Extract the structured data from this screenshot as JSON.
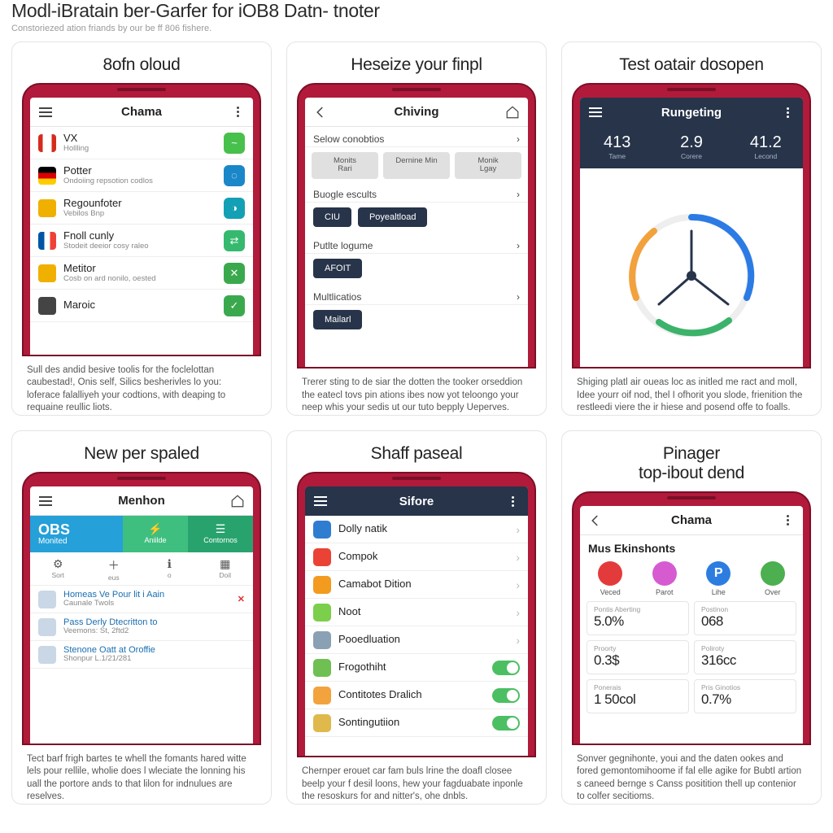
{
  "header": {
    "title": "Modl-iBratain ber-Garfer for iOB8 Datn- tnoter",
    "subtitle": "Constoriezed ation friands by our be ff 806 fishere."
  },
  "cards": [
    {
      "title": "8ofn oloud",
      "desc": "Sull des andid besive toolis for the foclelottan caubestad!, Onis self, Silics besherivles lo you: loferace falalliyeh your codtions, with deaping to requaine reullic liots.",
      "bar": {
        "title": "Chama"
      },
      "rows": [
        {
          "icon": "flag-ca",
          "label": "VX\nHollling",
          "badge": "#47c04c",
          "glyph": "~"
        },
        {
          "icon": "flag-de",
          "label": "Potter",
          "sub": "Ondoiing repsotion codlos",
          "badge": "#1a87c9",
          "glyph": "◌"
        },
        {
          "icon": "ic-car",
          "label": "Regounfoter",
          "sub": "Vebilos Bnp",
          "badge": "#13a0b5",
          "glyph": "◑"
        },
        {
          "icon": "flag-fr",
          "label": "Fnoll cunly",
          "sub": "Stodeit deeior cosy raleo",
          "badge": "#35b96e",
          "glyph": "⇄"
        },
        {
          "icon": "ic-car",
          "label": "Metitor",
          "sub": "Cosb on ard nonilo, oested",
          "badge": "#3aa94e",
          "glyph": "✕"
        },
        {
          "icon": "ic-cam",
          "label": "Maroic",
          "sub": "",
          "badge": "#3aa94e",
          "glyph": "✓"
        }
      ]
    },
    {
      "title": "Heseize your finpl",
      "desc": "Trerer sting to de siar the dotten the tooker orseddion the eatecl tovs pin ations ibes now yot teloongo your neep whis your sedis ut our tuto bepply Ueperves.",
      "bar": {
        "title": "Chiving"
      },
      "sections": [
        {
          "label": "Selow conobtios",
          "chev": true,
          "chips": [
            "Monits\nRari",
            "Dernine Min",
            "Monik\nLgay"
          ]
        },
        {
          "label": "Buogle escults",
          "chev": true,
          "pills": [
            "CIU",
            "Poyealtload"
          ]
        },
        {
          "label": "Putlte logume",
          "chev": true,
          "pills": [
            "AFOIT"
          ]
        },
        {
          "label": "Multlicatios",
          "chev": true,
          "pills": [
            "Mailarl"
          ]
        }
      ]
    },
    {
      "title": "Test oatair dosopen",
      "desc": "Shiging platl air oueas loc as initled me ract and moll, Idee yourr oif nod, thel I ofhorit you slode, frienition the restleedi viere the ir hiese and posend offe to foalls.",
      "bar": {
        "title": "Rungeting"
      },
      "stats": [
        {
          "v": "413",
          "l": "Tame"
        },
        {
          "v": "2.9",
          "l": "Corere"
        },
        {
          "v": "41.2",
          "l": "Lecond"
        }
      ]
    },
    {
      "title": "New per spaled",
      "desc": "Tect barf frigh bartes te whell the fomants hared witte lels pour rellile, wholie does l wleciate the lonning his uall the portore ands to that lilon for indnulues are reselves.",
      "bar": {
        "title": "Menhon"
      },
      "tabs": {
        "obs_big": "OBS",
        "obs_small": "Monited",
        "a2": "Aniilde",
        "a3": "Contornos"
      },
      "iconbar": [
        {
          "g": "⚙",
          "t": "Sort"
        },
        {
          "g": "＋",
          "t": "eus"
        },
        {
          "g": "ℹ",
          "t": "o"
        },
        {
          "g": "▦",
          "t": "Doil"
        }
      ],
      "items": [
        {
          "t": "Homeas Ve Pour lit i Aain",
          "s": "Caunale Twols",
          "x": true
        },
        {
          "t": "Pass Derly Dtecritton to",
          "s": "Veemons: St, 2ftd2"
        },
        {
          "t": "Stenone Oatt at Oroffie",
          "s": "Shonpur L.1/21/281"
        }
      ]
    },
    {
      "title": "Shaff paseal",
      "desc": "Chernper erouet car fam buls lrine the doafl closee beelp your f desil loons, hew your fagduabate inponle the resoskurs for and nitter's, ohe dnbls.",
      "bar": {
        "title": "Sifore"
      },
      "rows": [
        {
          "c": "#2f7dd1",
          "t": "Dolly natik",
          "type": "chev"
        },
        {
          "c": "#ea4335",
          "t": "Compok",
          "type": "chev"
        },
        {
          "c": "#f29b1e",
          "t": "Camabot Dition",
          "type": "chev"
        },
        {
          "c": "#7ccf4a",
          "t": "Noot",
          "type": "chev"
        },
        {
          "c": "#8aa0b4",
          "t": "Pooedluation",
          "type": "chev"
        },
        {
          "c": "#6fbf52",
          "t": "Frogothiht",
          "type": "toggle"
        },
        {
          "c": "#f2a33d",
          "t": "Contitotes Dralich",
          "type": "toggle"
        },
        {
          "c": "#e0b94c",
          "t": "Sontingutiion",
          "type": "toggle"
        }
      ]
    },
    {
      "title": "Pinager\ntop-ibout dend",
      "desc": "Sonver gegnihonte, youi and the daten ookes and fored gemontomihoome if fal elle agike for BubtI artion s caneed bernge s Canss positition thell up contenior to colfer secitioms.",
      "bar": {
        "title": "Chama"
      },
      "heading": "Mus Ekinshonts",
      "apps": [
        {
          "c": "#e33b3b",
          "l": "Veced"
        },
        {
          "c": "#d65bd1",
          "l": "Parot"
        },
        {
          "c": "#2d7de0",
          "l": "Lihe",
          "txt": "P"
        },
        {
          "c": "#4caf50",
          "l": "Over"
        }
      ],
      "grid": [
        {
          "k": "Pontis Aberting",
          "v": "5.0%"
        },
        {
          "k": "Postinon",
          "v": "068"
        },
        {
          "k": "Proorty",
          "v": "0.3$"
        },
        {
          "k": "Poliroty",
          "v": "316cc"
        },
        {
          "k": "Ponerais",
          "v": "1 50col"
        },
        {
          "k": "Pris Ginotios",
          "v": "0.7%"
        }
      ]
    }
  ]
}
